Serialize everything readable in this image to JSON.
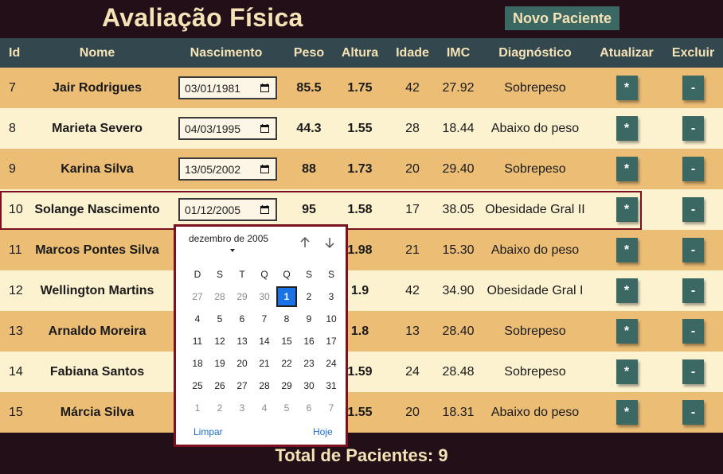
{
  "header": {
    "title": "Avaliação Física",
    "new_button": "Novo Paciente"
  },
  "columns": [
    "Id",
    "Nome",
    "Nascimento",
    "Peso",
    "Altura",
    "Idade",
    "IMC",
    "Diagnóstico",
    "Atualizar",
    "Excluir"
  ],
  "rows": [
    {
      "id": "7",
      "nome": "Jair Rodrigues",
      "nascimento": "03/01/1981",
      "peso": "85.5",
      "altura": "1.75",
      "idade": "42",
      "imc": "27.92",
      "diagnostico": "Sobrepeso",
      "update": "*",
      "delete": "-"
    },
    {
      "id": "8",
      "nome": "Marieta Severo",
      "nascimento": "04/03/1995",
      "peso": "44.3",
      "altura": "1.55",
      "idade": "28",
      "imc": "18.44",
      "diagnostico": "Abaixo do peso",
      "update": "*",
      "delete": "-"
    },
    {
      "id": "9",
      "nome": "Karina Silva",
      "nascimento": "13/05/2002",
      "peso": "88",
      "altura": "1.73",
      "idade": "20",
      "imc": "29.40",
      "diagnostico": "Sobrepeso",
      "update": "*",
      "delete": "-"
    },
    {
      "id": "10",
      "nome": "Solange Nascimento",
      "nascimento": "01/12/2005",
      "peso": "95",
      "altura": "1.58",
      "idade": "17",
      "imc": "38.05",
      "diagnostico": "Obesidade Gral II",
      "update": "*",
      "delete": "-"
    },
    {
      "id": "11",
      "nome": "Marcos Pontes Silva",
      "nascimento": "",
      "peso": "",
      "altura": "1.98",
      "idade": "21",
      "imc": "15.30",
      "diagnostico": "Abaixo do peso",
      "update": "*",
      "delete": "-"
    },
    {
      "id": "12",
      "nome": "Wellington Martins",
      "nascimento": "",
      "peso": "",
      "altura": "1.9",
      "idade": "42",
      "imc": "34.90",
      "diagnostico": "Obesidade Gral I",
      "update": "*",
      "delete": "-"
    },
    {
      "id": "13",
      "nome": "Arnaldo Moreira",
      "nascimento": "",
      "peso": "",
      "altura": "1.8",
      "idade": "13",
      "imc": "28.40",
      "diagnostico": "Sobrepeso",
      "update": "*",
      "delete": "-"
    },
    {
      "id": "14",
      "nome": "Fabiana Santos",
      "nascimento": "",
      "peso": "",
      "altura": "1.59",
      "idade": "24",
      "imc": "28.48",
      "diagnostico": "Sobrepeso",
      "update": "*",
      "delete": "-"
    },
    {
      "id": "15",
      "nome": "Márcia Silva",
      "nascimento": "",
      "peso": "",
      "altura": "1.55",
      "idade": "20",
      "imc": "18.31",
      "diagnostico": "Abaixo do peso",
      "update": "*",
      "delete": "-"
    }
  ],
  "footer": {
    "total": "Total de Pacientes: 9"
  },
  "datepicker": {
    "month_label": "dezembro de 2005",
    "weekdays": [
      "D",
      "S",
      "T",
      "Q",
      "Q",
      "S",
      "S"
    ],
    "days": [
      {
        "d": "27",
        "m": true
      },
      {
        "d": "28",
        "m": true
      },
      {
        "d": "29",
        "m": true
      },
      {
        "d": "30",
        "m": true
      },
      {
        "d": "1",
        "s": true
      },
      {
        "d": "2"
      },
      {
        "d": "3"
      },
      {
        "d": "4"
      },
      {
        "d": "5"
      },
      {
        "d": "6"
      },
      {
        "d": "7"
      },
      {
        "d": "8"
      },
      {
        "d": "9"
      },
      {
        "d": "10"
      },
      {
        "d": "11"
      },
      {
        "d": "12"
      },
      {
        "d": "13"
      },
      {
        "d": "14"
      },
      {
        "d": "15"
      },
      {
        "d": "16"
      },
      {
        "d": "17"
      },
      {
        "d": "18"
      },
      {
        "d": "19"
      },
      {
        "d": "20"
      },
      {
        "d": "21"
      },
      {
        "d": "22"
      },
      {
        "d": "23"
      },
      {
        "d": "24"
      },
      {
        "d": "25"
      },
      {
        "d": "26"
      },
      {
        "d": "27"
      },
      {
        "d": "28"
      },
      {
        "d": "29"
      },
      {
        "d": "30"
      },
      {
        "d": "31"
      },
      {
        "d": "1",
        "m": true
      },
      {
        "d": "2",
        "m": true
      },
      {
        "d": "3",
        "m": true
      },
      {
        "d": "4",
        "m": true
      },
      {
        "d": "5",
        "m": true
      },
      {
        "d": "6",
        "m": true
      },
      {
        "d": "7",
        "m": true
      }
    ],
    "clear_label": "Limpar",
    "today_label": "Hoje",
    "up_icon": "arrow-up-icon",
    "down_icon": "arrow-down-icon"
  },
  "colors": {
    "background": "#220f18",
    "header_row": "#33474f",
    "row_odd": "#ebbd75",
    "row_even": "#fdf2d0",
    "button": "#3c6864",
    "title_text": "#f5e3b6",
    "selected_outline": "#7a1020",
    "selected_day": "#1a73e8"
  }
}
